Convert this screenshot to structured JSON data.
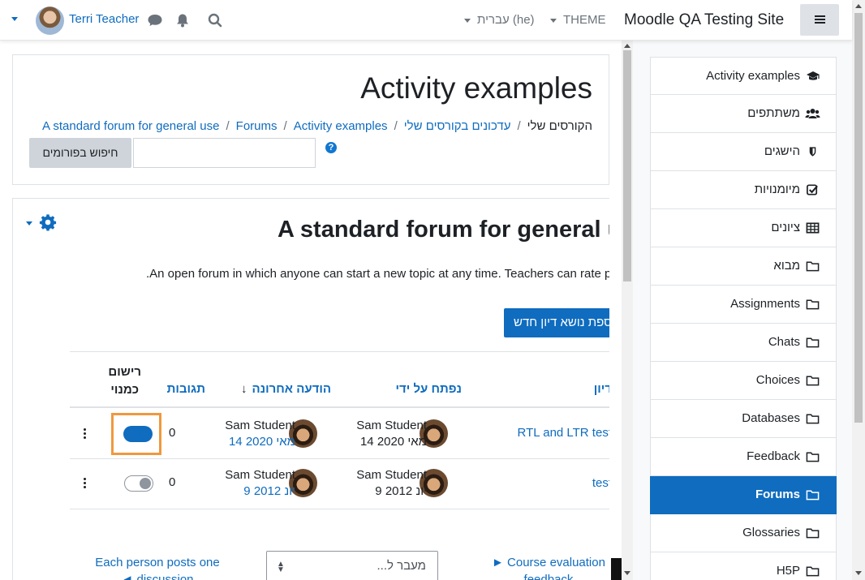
{
  "navbar": {
    "user_name": "Terri Teacher",
    "language": "עברית (he)",
    "theme": "THEME",
    "site_name": "Moodle QA Testing Site"
  },
  "header": {
    "title": "Activity examples",
    "breadcrumb": [
      "A standard forum for general use",
      "Forums",
      "Activity examples",
      "הקורסים שלי",
      "עדכונים בקורסים שלי"
    ],
    "search_button": "חיפוש בפורומים",
    "search_placeholder": "",
    "help": "?"
  },
  "forum": {
    "title": "A standard forum for general u",
    "intro": ".An open forum in which anyone can start a new topic at any time. Teachers can rate p",
    "add_button": "ספת נושא דיון חדש"
  },
  "table": {
    "columns": {
      "discussion": "דיון",
      "started_by": "נפתח על ידי",
      "last_post": "הודעה אחרונה",
      "sort_arrow": "↓",
      "replies": "תגובות",
      "subscribe_line1": "רישום",
      "subscribe_line2": "כמנוי"
    },
    "rows": [
      {
        "discussion": "RTL and LTR test",
        "started_by_name": "Sam Student",
        "started_by_date": "14 מאי 2020",
        "last_post_name": "Sam Student",
        "last_post_date": "14 מאי 2020",
        "replies": "0",
        "subscribed": true
      },
      {
        "discussion": "test",
        "started_by_name": "Sam Student",
        "started_by_date": "9 יונ 2012",
        "last_post_name": "Sam Student",
        "last_post_date": "9 יונ 2012",
        "replies": "0",
        "subscribed": false
      }
    ]
  },
  "pager": {
    "prev_line1": "Each person posts one",
    "prev_line2": "◄ discussion",
    "jump_placeholder": "...מעבר ל",
    "next_line1": "► Course evaluation",
    "next_line2": "feedback"
  },
  "drawer": {
    "items": [
      {
        "label": "Activity examples",
        "icon": "graduation-cap-icon",
        "active": false
      },
      {
        "label": "משתתפים",
        "icon": "users-icon",
        "active": false
      },
      {
        "label": "הישגים",
        "icon": "shield-icon",
        "active": false
      },
      {
        "label": "מיומנויות",
        "icon": "checkbox-icon",
        "active": false
      },
      {
        "label": "ציונים",
        "icon": "table-icon",
        "active": false
      },
      {
        "label": "מבוא",
        "icon": "folder-icon",
        "active": false
      },
      {
        "label": "Assignments",
        "icon": "folder-icon",
        "active": false
      },
      {
        "label": "Chats",
        "icon": "folder-icon",
        "active": false
      },
      {
        "label": "Choices",
        "icon": "folder-icon",
        "active": false
      },
      {
        "label": "Databases",
        "icon": "folder-icon",
        "active": false
      },
      {
        "label": "Feedback",
        "icon": "folder-icon",
        "active": false
      },
      {
        "label": "Forums",
        "icon": "folder-icon",
        "active": true
      },
      {
        "label": "Glossaries",
        "icon": "folder-icon",
        "active": false
      },
      {
        "label": "H5P",
        "icon": "folder-icon",
        "active": false
      }
    ]
  },
  "colors": {
    "primary": "#0f6cbf",
    "focus_outline": "#f0983e",
    "secondary_button": "#ced4da"
  }
}
